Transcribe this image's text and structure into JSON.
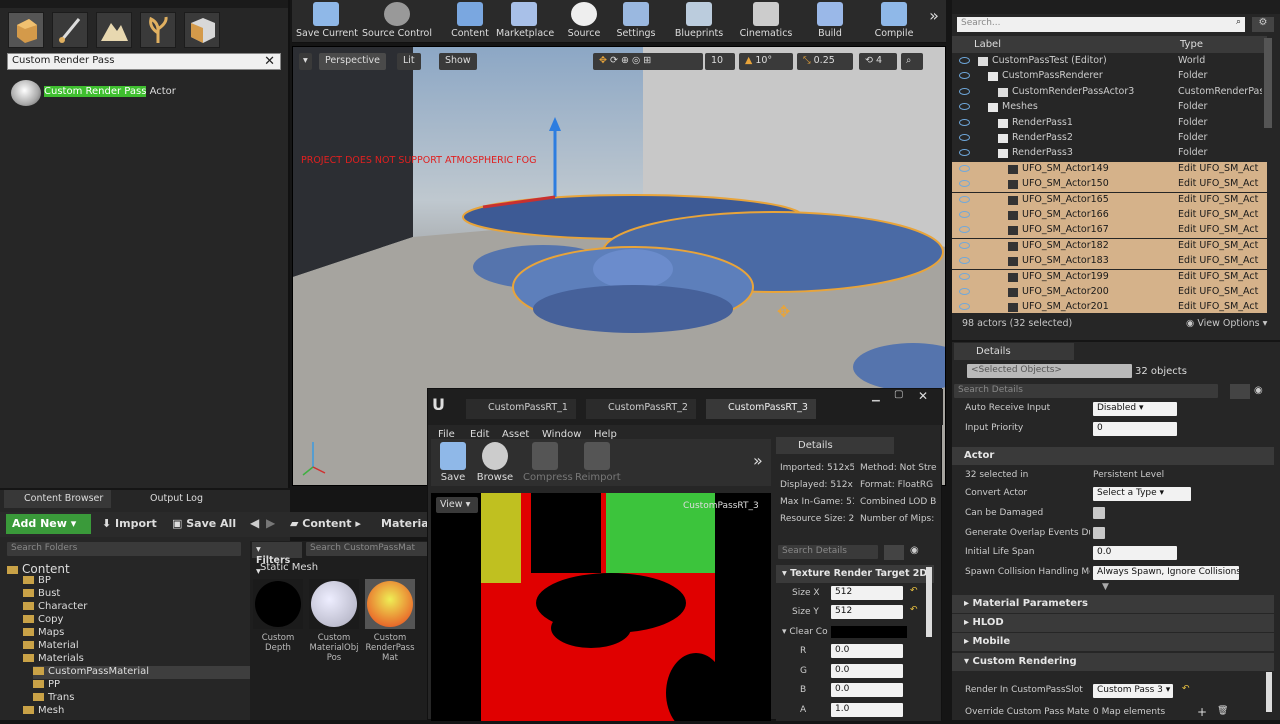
{
  "modes": {
    "search_value": "Custom Render Pass",
    "result_highlight": "Custom Render Pass",
    "result_suffix": " Actor"
  },
  "toolbar": {
    "items": [
      "Save Current",
      "Source Control",
      "Content",
      "Marketplace",
      "Source",
      "Settings",
      "Blueprints",
      "Cinematics",
      "Build",
      "Compile"
    ]
  },
  "viewport": {
    "perspective": "Perspective",
    "lit": "Lit",
    "show": "Show",
    "grid": "10",
    "rot": "10°",
    "scale": "0.25",
    "cam": "4",
    "warning": "PROJECT DOES NOT SUPPORT ATMOSPHERIC FOG"
  },
  "outliner": {
    "search_placeholder": "Search...",
    "col_label": "Label",
    "col_type": "Type",
    "rows": [
      {
        "label": "CustomPassTest (Editor)",
        "type": "World",
        "indent": 18,
        "selected": false
      },
      {
        "label": "CustomPassRenderer",
        "type": "Folder",
        "indent": 28,
        "selected": false
      },
      {
        "label": "CustomRenderPassActor3",
        "type": "CustomRenderPas",
        "indent": 38,
        "selected": false
      },
      {
        "label": "Meshes",
        "type": "Folder",
        "indent": 28,
        "selected": false
      },
      {
        "label": "RenderPass1",
        "type": "Folder",
        "indent": 38,
        "selected": false
      },
      {
        "label": "RenderPass2",
        "type": "Folder",
        "indent": 38,
        "selected": false
      },
      {
        "label": "RenderPass3",
        "type": "Folder",
        "indent": 38,
        "selected": false
      },
      {
        "label": "UFO_SM_Actor149",
        "type": "Edit UFO_SM_Act",
        "indent": 48,
        "selected": true
      },
      {
        "label": "UFO_SM_Actor150",
        "type": "Edit UFO_SM_Act",
        "indent": 48,
        "selected": true
      },
      {
        "label": "UFO_SM_Actor165",
        "type": "Edit UFO_SM_Act",
        "indent": 48,
        "selected": true
      },
      {
        "label": "UFO_SM_Actor166",
        "type": "Edit UFO_SM_Act",
        "indent": 48,
        "selected": true
      },
      {
        "label": "UFO_SM_Actor167",
        "type": "Edit UFO_SM_Act",
        "indent": 48,
        "selected": true
      },
      {
        "label": "UFO_SM_Actor182",
        "type": "Edit UFO_SM_Act",
        "indent": 48,
        "selected": true
      },
      {
        "label": "UFO_SM_Actor183",
        "type": "Edit UFO_SM_Act",
        "indent": 48,
        "selected": true
      },
      {
        "label": "UFO_SM_Actor199",
        "type": "Edit UFO_SM_Act",
        "indent": 48,
        "selected": true
      },
      {
        "label": "UFO_SM_Actor200",
        "type": "Edit UFO_SM_Act",
        "indent": 48,
        "selected": true
      },
      {
        "label": "UFO_SM_Actor201",
        "type": "Edit UFO_SM_Act",
        "indent": 48,
        "selected": true
      }
    ],
    "actor_count": "98 actors (32 selected)",
    "view_options": "View Options"
  },
  "details": {
    "tab": "Details",
    "selected": "<Selected Objects>",
    "objects": "32 objects",
    "search_placeholder": "Search Details",
    "auto_receive_input": {
      "key": "Auto Receive Input",
      "value": "Disabled"
    },
    "input_priority": {
      "key": "Input Priority",
      "value": "0"
    },
    "actor_section": "Actor",
    "selected_in": {
      "key": "32 selected in",
      "value": "Persistent Level"
    },
    "convert_actor": {
      "key": "Convert Actor",
      "value": "Select a Type"
    },
    "can_be_damaged": "Can be Damaged",
    "gen_overlap": "Generate Overlap Events During",
    "initial_life": {
      "key": "Initial Life Span",
      "value": "0.0"
    },
    "spawn_collision": {
      "key": "Spawn Collision Handling Meth",
      "value": "Always Spawn, Ignore Collisions"
    },
    "material_parameters": "Material Parameters",
    "hlod": "HLOD",
    "mobile": "Mobile",
    "custom_rendering": "Custom Rendering",
    "render_slot": {
      "key": "Render In CustomPassSlot",
      "value": "Custom Pass 3"
    },
    "override": {
      "key": "Override Custom Pass Materi",
      "value": "0 Map elements"
    }
  },
  "content_browser": {
    "tab1": "Content Browser",
    "tab2": "Output Log",
    "add_new": "Add New",
    "import": "Import",
    "save_all": "Save All",
    "path_root": "Content",
    "path_sub": "Material",
    "search_folders": "Search Folders",
    "filters": "Filters",
    "search_assets": "Search CustomPassMat",
    "category": "Static Mesh",
    "folders": [
      {
        "name": "Content",
        "depth": 0,
        "big": true
      },
      {
        "name": "BP",
        "depth": 1
      },
      {
        "name": "Bust",
        "depth": 1
      },
      {
        "name": "Character",
        "depth": 1
      },
      {
        "name": "Copy",
        "depth": 1
      },
      {
        "name": "Maps",
        "depth": 1
      },
      {
        "name": "Material",
        "depth": 1
      },
      {
        "name": "Materials",
        "depth": 1
      },
      {
        "name": "CustomPassMaterial",
        "depth": 2,
        "selected": true
      },
      {
        "name": "PP",
        "depth": 2
      },
      {
        "name": "Trans",
        "depth": 2
      },
      {
        "name": "Mesh",
        "depth": 1
      }
    ],
    "assets": [
      {
        "name": "Custom Depth"
      },
      {
        "name": "Custom MaterialObj Pos"
      },
      {
        "name": "Custom RenderPass Mat"
      }
    ]
  },
  "texture_editor": {
    "tabs": [
      "CustomPassRT_1",
      "CustomPassRT_2",
      "CustomPassRT_3"
    ],
    "menu": [
      "File",
      "Edit",
      "Asset",
      "Window",
      "Help"
    ],
    "tools": [
      "Save",
      "Browse",
      "Compress",
      "Reimport"
    ],
    "view_btn": "View",
    "overlay_name": "CustomPassRT_3",
    "details_tab": "Details",
    "info": [
      [
        "Imported: 512x5",
        "Method: Not Stre"
      ],
      [
        "Displayed: 512x!",
        "Format: FloatRG"
      ],
      [
        "Max In-Game: 51",
        "Combined LOD B"
      ],
      [
        "Resource Size: 2(",
        "Number of Mips:"
      ]
    ],
    "search_placeholder": "Search Details",
    "section": "Texture Render Target 2D",
    "size_x": {
      "key": "Size X",
      "value": "512"
    },
    "size_y": {
      "key": "Size Y",
      "value": "512"
    },
    "clear_color": "Clear Co",
    "rgba": [
      {
        "key": "R",
        "value": "0.0"
      },
      {
        "key": "G",
        "value": "0.0"
      },
      {
        "key": "B",
        "value": "0.0"
      },
      {
        "key": "A",
        "value": "1.0"
      }
    ]
  }
}
